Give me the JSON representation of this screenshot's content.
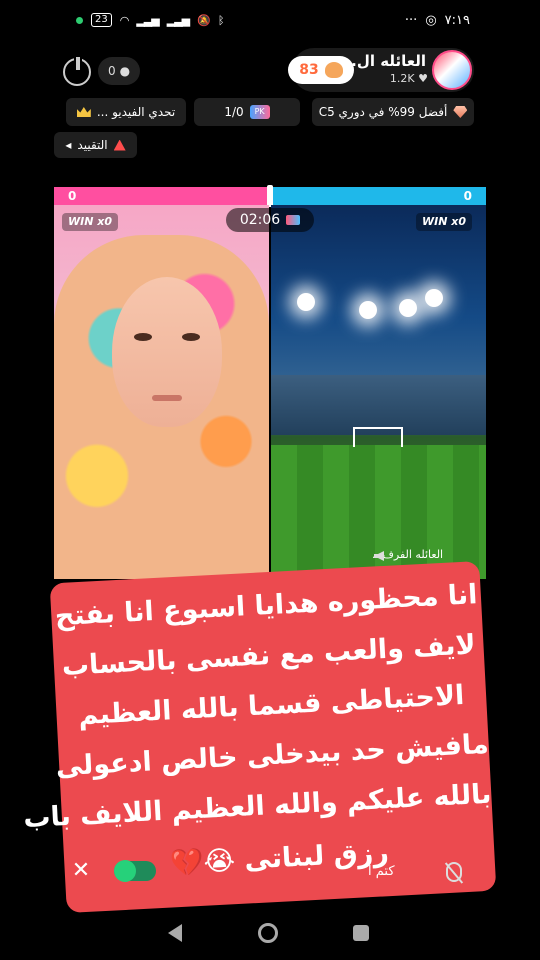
{
  "status_bar": {
    "battery": "23",
    "time": "٧:١٩",
    "more": "···"
  },
  "header": {
    "host_name": "العائله ال..",
    "host_likes": "1.2K",
    "score": "83",
    "viewer_count": "0"
  },
  "chips": {
    "league": "أفضل 99% في دوري C5",
    "count": "1/0",
    "challenge": "تحدي الفيديو ..."
  },
  "restriction": {
    "label": "التقييد"
  },
  "battle": {
    "left_score": "0",
    "right_score": "0",
    "left_win": "WIN x0",
    "right_win": "WIN x0",
    "timer": "02:06",
    "guest_name": "العائله الفرف..."
  },
  "caption": {
    "lines": [
      "انا محظوره هدايا اسبوع انا بفتح",
      "لايف والعب مع نفسى بالحساب",
      "الاحتياطى قسما بالله العظيم",
      "مافيش حد بيدخلى خالص ادعولى",
      "بالله عليكم والله العظيم اللايف باب",
      "رزق لبناتى 😭💔"
    ]
  },
  "controls": {
    "close": "✕",
    "mute_label": "كتم ا"
  },
  "colors": {
    "pk_left": "#ff4fa0",
    "pk_right": "#1fb8ea",
    "caption_bg": "#ec4a4f",
    "toggle_on": "#26d17a"
  },
  "icons": {
    "power": "power-icon",
    "user": "user-icon",
    "heart": "heart-icon",
    "gem": "gem-icon",
    "crown": "crown-icon",
    "warning": "warning-icon",
    "mic_off": "mic-off-icon"
  }
}
